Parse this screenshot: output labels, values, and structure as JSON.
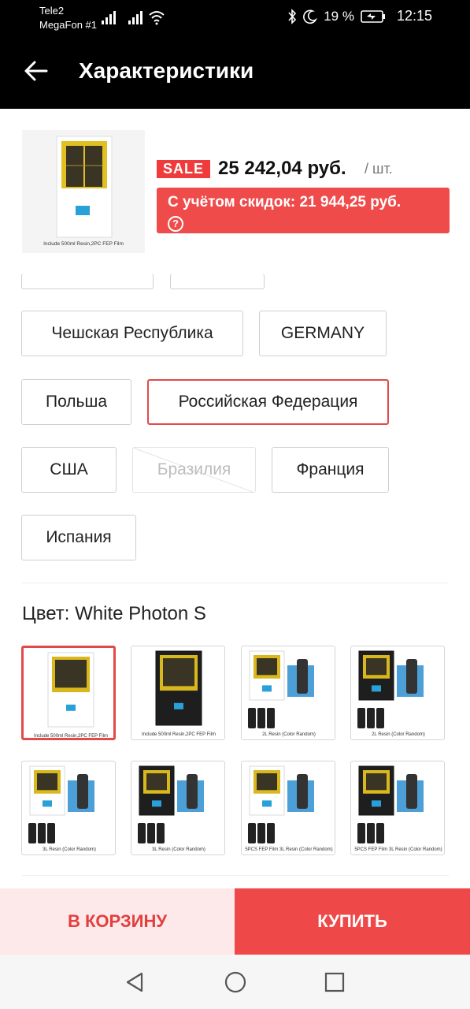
{
  "status_bar": {
    "carrier1": "Tele2",
    "carrier2": "MegaFon #1",
    "battery": "19 %",
    "time": "12:15"
  },
  "header": {
    "title": "Характеристики"
  },
  "product": {
    "image_caption": "Include 500ml Resin,2PC FEP Film",
    "sale_badge": "SALE",
    "price": "25 242,04 руб.",
    "per_unit": "/ шт.",
    "discount_text": "С учётом скидок: 21 944,25 руб.",
    "help": "?"
  },
  "ship_from": {
    "options": [
      {
        "label": "Чешская Республика",
        "state": "normal"
      },
      {
        "label": "GERMANY",
        "state": "normal"
      },
      {
        "label": "Польша",
        "state": "normal"
      },
      {
        "label": "Российская Федерация",
        "state": "selected"
      },
      {
        "label": "США",
        "state": "normal"
      },
      {
        "label": "Бразилия",
        "state": "disabled"
      },
      {
        "label": "Франция",
        "state": "normal"
      },
      {
        "label": "Испания",
        "state": "normal"
      }
    ]
  },
  "color": {
    "label": "Цвет: White Photon S",
    "swatches": [
      {
        "variant": "white",
        "caption": "Include 500ml Resin,2PC FEP Film",
        "selected": true
      },
      {
        "variant": "black",
        "caption": "Include 500ml Resin,2PC FEP Film",
        "selected": false
      },
      {
        "variant": "white",
        "caption": "2L Resin (Color Random)",
        "selected": false
      },
      {
        "variant": "black",
        "caption": "2L Resin (Color Random)",
        "selected": false
      },
      {
        "variant": "white",
        "caption": "3L Resin (Color Random)",
        "selected": false
      },
      {
        "variant": "black",
        "caption": "3L Resin (Color Random)",
        "selected": false
      },
      {
        "variant": "white",
        "caption": "5PCS FEP Film 3L Resin (Color Random)",
        "selected": false
      },
      {
        "variant": "black",
        "caption": "5PCS FEP Film 3L Resin (Color Random)",
        "selected": false
      }
    ]
  },
  "actions": {
    "cart_label": "В КОРЗИНУ",
    "buy_label": "КУПИТЬ"
  },
  "colors": {
    "accent": "#ef4848",
    "cart_bg": "#fde9e9",
    "topbar": "#000000"
  },
  "icons": {
    "back": "arrow-left-icon",
    "help": "question-circle-icon",
    "nav_back": "triangle-back-icon",
    "nav_home": "circle-home-icon",
    "nav_recent": "square-recent-icon"
  }
}
